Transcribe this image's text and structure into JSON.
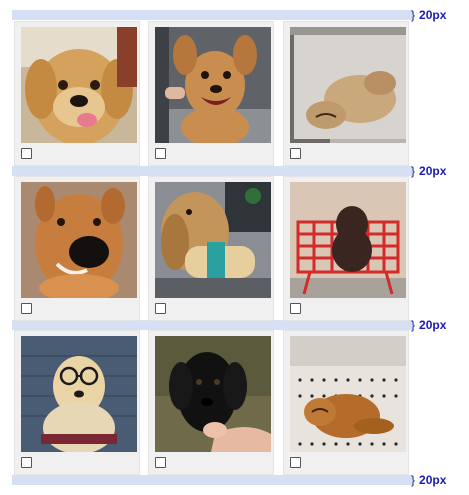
{
  "spacing_labels": [
    "20px",
    "20px",
    "20px",
    "20px"
  ],
  "colors": {
    "gap_band": "#d6e0f5",
    "gap_label": "#1a1ab8",
    "card_background": "#f0f0f0"
  },
  "photos": [
    {
      "subject": "golden-retriever-puppy-tongue",
      "selected": false
    },
    {
      "subject": "tan-dog-smiling-bath",
      "selected": false
    },
    {
      "subject": "sleeping-puppy-sink",
      "selected": false
    },
    {
      "subject": "dog-with-muzzle",
      "selected": false
    },
    {
      "subject": "retriever-with-toy",
      "selected": false
    },
    {
      "subject": "puppy-in-shopping-cart",
      "selected": false
    },
    {
      "subject": "golden-retriever-with-glasses",
      "selected": false
    },
    {
      "subject": "black-lab-puppy",
      "selected": false
    },
    {
      "subject": "retriever-lying-on-floor",
      "selected": false
    }
  ]
}
